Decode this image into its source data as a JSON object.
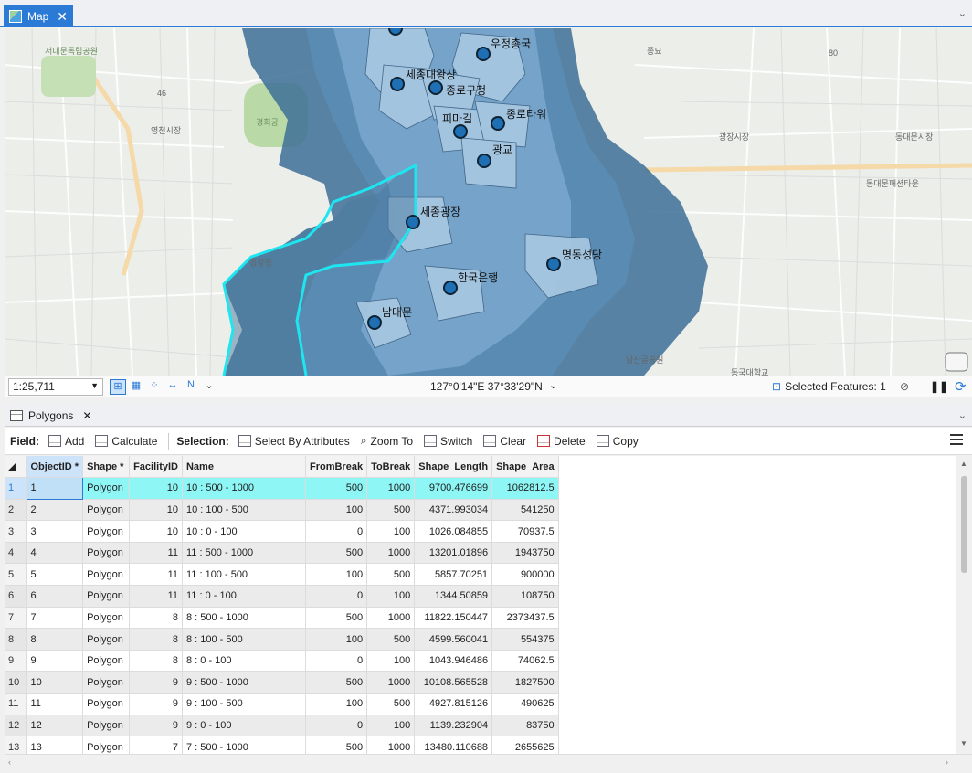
{
  "map_tab": {
    "title": "Map"
  },
  "map_labels": {
    "park": "서대문독립공원",
    "gyeonghuigung": "경희궁",
    "yeongcheon": "영천시장",
    "jongmyo": "종묘",
    "gwangjang": "광장시장",
    "dongdaemun": "동대문시장",
    "dongdaemun_fashion": "동대문패션타운",
    "seoul_station_area": "경찰청",
    "dongguk": "동국대학교",
    "namsan": "남산골공원",
    "road_46": "46",
    "road_80": "80"
  },
  "facilities": [
    {
      "name": "우정총국"
    },
    {
      "name": "세종대왕상"
    },
    {
      "name": "종로구청"
    },
    {
      "name": "피마길"
    },
    {
      "name": "종로타워"
    },
    {
      "name": "광교"
    },
    {
      "name": "세종광장"
    },
    {
      "name": "명동성당"
    },
    {
      "name": "한국은행"
    },
    {
      "name": "남대문"
    }
  ],
  "status_bar": {
    "scale": "1:25,711",
    "coordinates": "127°0'14\"E 37°33'29\"N",
    "selected_features": "Selected Features: 1"
  },
  "table_panel": {
    "tab_title": "Polygons",
    "toolbar": {
      "field_label": "Field:",
      "add": "Add",
      "calculate": "Calculate",
      "selection_label": "Selection:",
      "select_by_attributes": "Select By Attributes",
      "zoom_to": "Zoom To",
      "switch": "Switch",
      "clear": "Clear",
      "delete": "Delete",
      "copy": "Copy"
    },
    "columns": [
      "ObjectID *",
      "Shape *",
      "FacilityID",
      "Name",
      "FromBreak",
      "ToBreak",
      "Shape_Length",
      "Shape_Area"
    ],
    "rows": [
      {
        "n": "1",
        "oid": "1",
        "shape": "Polygon",
        "fid": "10",
        "name": "10 : 500 - 1000",
        "from": "500",
        "to": "1000",
        "len": "9700.476699",
        "area": "1062812.5"
      },
      {
        "n": "2",
        "oid": "2",
        "shape": "Polygon",
        "fid": "10",
        "name": "10 : 100 - 500",
        "from": "100",
        "to": "500",
        "len": "4371.993034",
        "area": "541250"
      },
      {
        "n": "3",
        "oid": "3",
        "shape": "Polygon",
        "fid": "10",
        "name": "10 : 0 - 100",
        "from": "0",
        "to": "100",
        "len": "1026.084855",
        "area": "70937.5"
      },
      {
        "n": "4",
        "oid": "4",
        "shape": "Polygon",
        "fid": "11",
        "name": "11 : 500 - 1000",
        "from": "500",
        "to": "1000",
        "len": "13201.01896",
        "area": "1943750"
      },
      {
        "n": "5",
        "oid": "5",
        "shape": "Polygon",
        "fid": "11",
        "name": "11 : 100 - 500",
        "from": "100",
        "to": "500",
        "len": "5857.70251",
        "area": "900000"
      },
      {
        "n": "6",
        "oid": "6",
        "shape": "Polygon",
        "fid": "11",
        "name": "11 : 0 - 100",
        "from": "0",
        "to": "100",
        "len": "1344.50859",
        "area": "108750"
      },
      {
        "n": "7",
        "oid": "7",
        "shape": "Polygon",
        "fid": "8",
        "name": "8 : 500 - 1000",
        "from": "500",
        "to": "1000",
        "len": "11822.150447",
        "area": "2373437.5"
      },
      {
        "n": "8",
        "oid": "8",
        "shape": "Polygon",
        "fid": "8",
        "name": "8 : 100 - 500",
        "from": "100",
        "to": "500",
        "len": "4599.560041",
        "area": "554375"
      },
      {
        "n": "9",
        "oid": "9",
        "shape": "Polygon",
        "fid": "8",
        "name": "8 : 0 - 100",
        "from": "0",
        "to": "100",
        "len": "1043.946486",
        "area": "74062.5"
      },
      {
        "n": "10",
        "oid": "10",
        "shape": "Polygon",
        "fid": "9",
        "name": "9 : 500 - 1000",
        "from": "500",
        "to": "1000",
        "len": "10108.565528",
        "area": "1827500"
      },
      {
        "n": "11",
        "oid": "11",
        "shape": "Polygon",
        "fid": "9",
        "name": "9 : 100 - 500",
        "from": "100",
        "to": "500",
        "len": "4927.815126",
        "area": "490625"
      },
      {
        "n": "12",
        "oid": "12",
        "shape": "Polygon",
        "fid": "9",
        "name": "9 : 0 - 100",
        "from": "0",
        "to": "100",
        "len": "1139.232904",
        "area": "83750"
      },
      {
        "n": "13",
        "oid": "13",
        "shape": "Polygon",
        "fid": "7",
        "name": "7 : 500 - 1000",
        "from": "500",
        "to": "1000",
        "len": "13480.110688",
        "area": "2655625"
      }
    ]
  },
  "colors": {
    "accent": "#2b7ad6",
    "selected_row": "#8ff6f6",
    "polygon_outer": "#3d6e96",
    "polygon_mid": "#5a8db5",
    "polygon_inner": "#9bbfdc",
    "selection_outline": "#1ee6f0"
  }
}
